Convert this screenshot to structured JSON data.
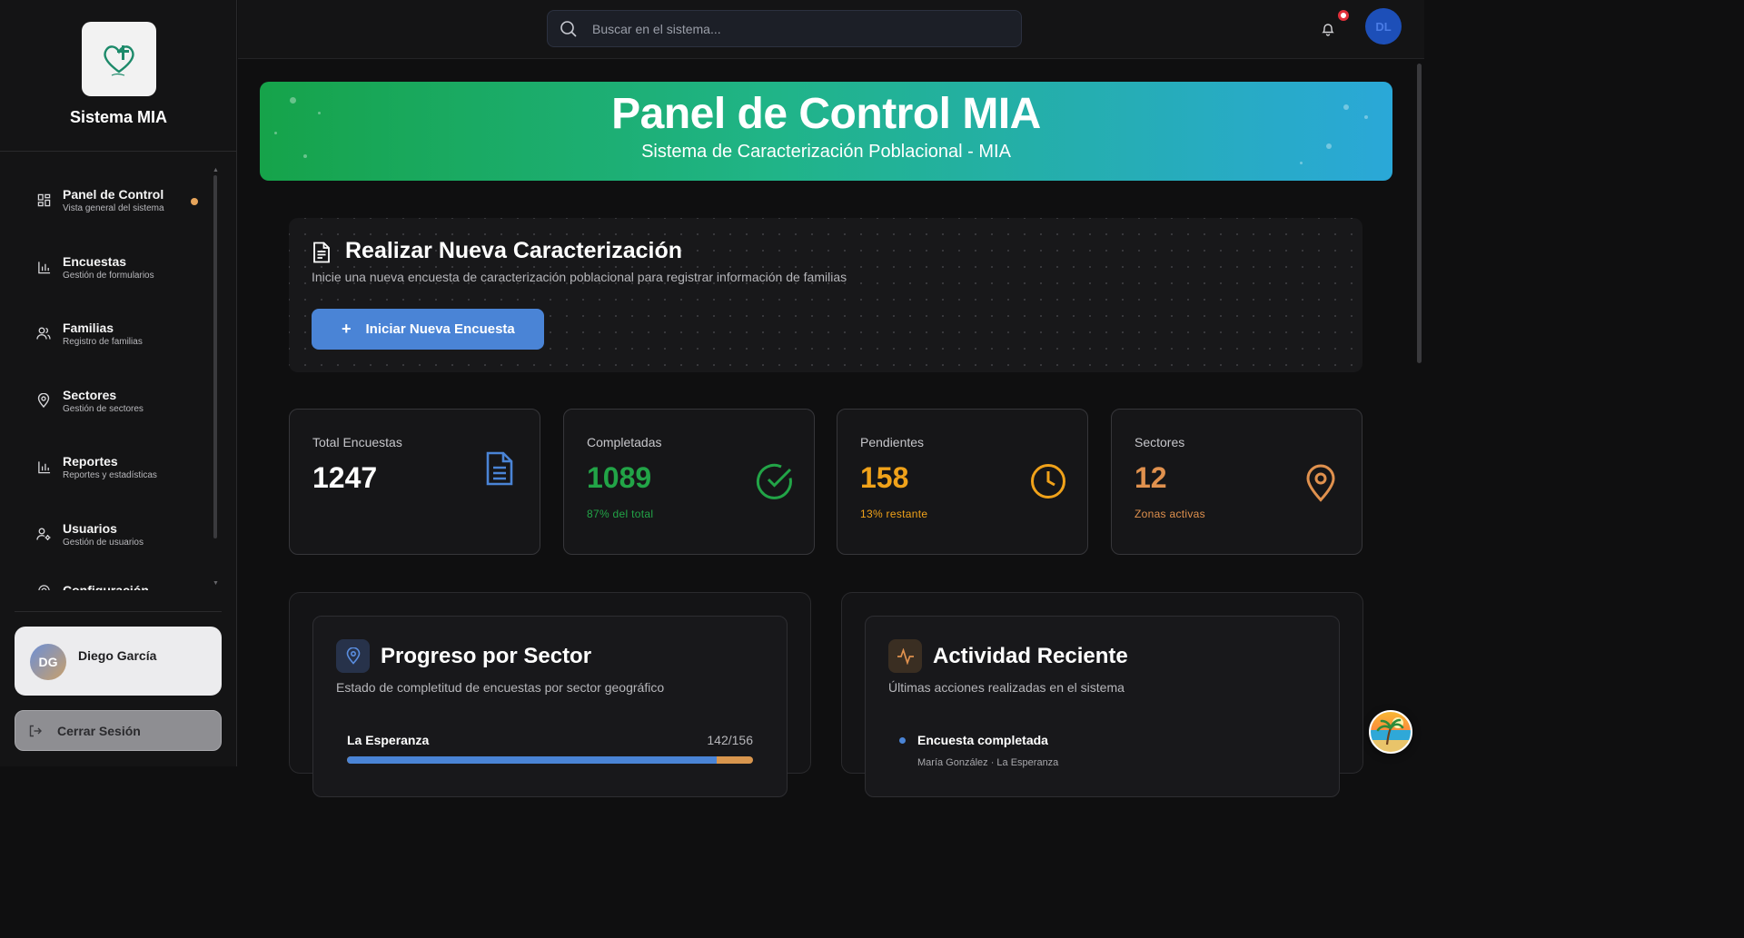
{
  "sidebar": {
    "app_name": "Sistema MIA",
    "items": [
      {
        "label": "Panel de Control",
        "sub": "Vista general del sistema",
        "icon": "dashboard-icon"
      },
      {
        "label": "Encuestas",
        "sub": "Gestión de formularios",
        "icon": "bar-chart-icon"
      },
      {
        "label": "Familias",
        "sub": "Registro de familias",
        "icon": "users-icon"
      },
      {
        "label": "Sectores",
        "sub": "Gestión de sectores",
        "icon": "map-pin-icon"
      },
      {
        "label": "Reportes",
        "sub": "Reportes y estadísticas",
        "icon": "bar-chart-icon"
      },
      {
        "label": "Usuarios",
        "sub": "Gestión de usuarios",
        "icon": "user-cog-icon"
      },
      {
        "label": "Configuración",
        "sub": "",
        "icon": "settings-icon"
      }
    ],
    "user": {
      "initials": "DG",
      "name": "Diego García"
    },
    "logout_label": "Cerrar Sesión"
  },
  "topbar": {
    "search_placeholder": "Buscar en el sistema...",
    "user_initials": "DL"
  },
  "hero": {
    "title": "Panel de Control MIA",
    "subtitle": "Sistema de Caracterización Poblacional - MIA"
  },
  "new_survey": {
    "title": "Realizar Nueva Caracterización",
    "description": "Inicie una nueva encuesta de caracterización poblacional para registrar información de familias",
    "button_label": "Iniciar Nueva Encuesta"
  },
  "stats": [
    {
      "label": "Total Encuestas",
      "value": "1247",
      "note": "",
      "color": "#ffffff",
      "icon": "document-icon"
    },
    {
      "label": "Completadas",
      "value": "1089",
      "note": "87% del total",
      "color": "#22a447",
      "icon": "check-circle-icon"
    },
    {
      "label": "Pendientes",
      "value": "158",
      "note": "13% restante",
      "color": "#f0a21a",
      "icon": "clock-icon"
    },
    {
      "label": "Sectores",
      "value": "12",
      "note": "Zonas activas",
      "color": "#e0914e",
      "icon": "map-pin-icon"
    }
  ],
  "progress": {
    "title": "Progreso por Sector",
    "subtitle": "Estado de completitud de encuestas por sector geográfico",
    "sectors": [
      {
        "name": "La Esperanza",
        "count": "142/156",
        "completed": 142,
        "total": 156
      }
    ]
  },
  "activity": {
    "title": "Actividad Reciente",
    "subtitle": "Últimas acciones realizadas en el sistema",
    "items": [
      {
        "title": "Encuesta completada",
        "meta": "María González · La Esperanza"
      }
    ]
  },
  "colors": {
    "accent_blue": "#4a84d6",
    "success_green": "#22a447",
    "warning_amber": "#f0a21a",
    "sector_orange": "#e0914e",
    "active_dot": "#e6a45a"
  }
}
